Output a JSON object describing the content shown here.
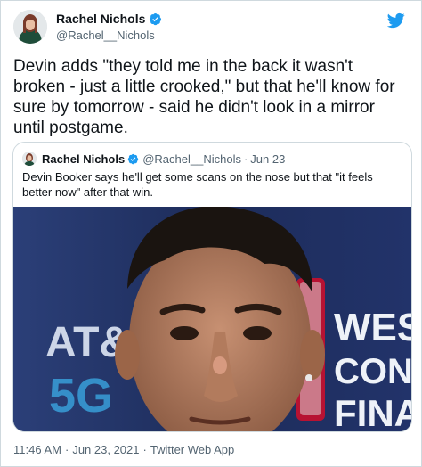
{
  "author": {
    "display_name": "Rachel Nichols",
    "handle": "@Rachel__Nichols",
    "verified": true
  },
  "tweet": {
    "text": "Devin adds \"they told me in the back it wasn't broken - just a little crooked,\" but that he'll know for sure by tomorrow - said he didn't look in a mirror until postgame."
  },
  "quoted_tweet": {
    "display_name": "Rachel Nichols",
    "handle": "@Rachel__Nichols",
    "separator": "·",
    "date": "Jun 23",
    "text": "Devin Booker says he'll get some scans on the nose but that \"it feels better now\" after that win.",
    "media_text": {
      "left_logo": "AT&",
      "left_sub": "5G",
      "right_lines": [
        "WEST",
        "CONFE",
        "FINA"
      ]
    }
  },
  "meta": {
    "time": "11:46 AM",
    "date": "Jun 23, 2021",
    "client": "Twitter Web App",
    "separator": "·"
  },
  "colors": {
    "accent": "#1d9bf0",
    "text": "#0f1419",
    "secondary": "#536471",
    "border": "#cfd9de"
  }
}
